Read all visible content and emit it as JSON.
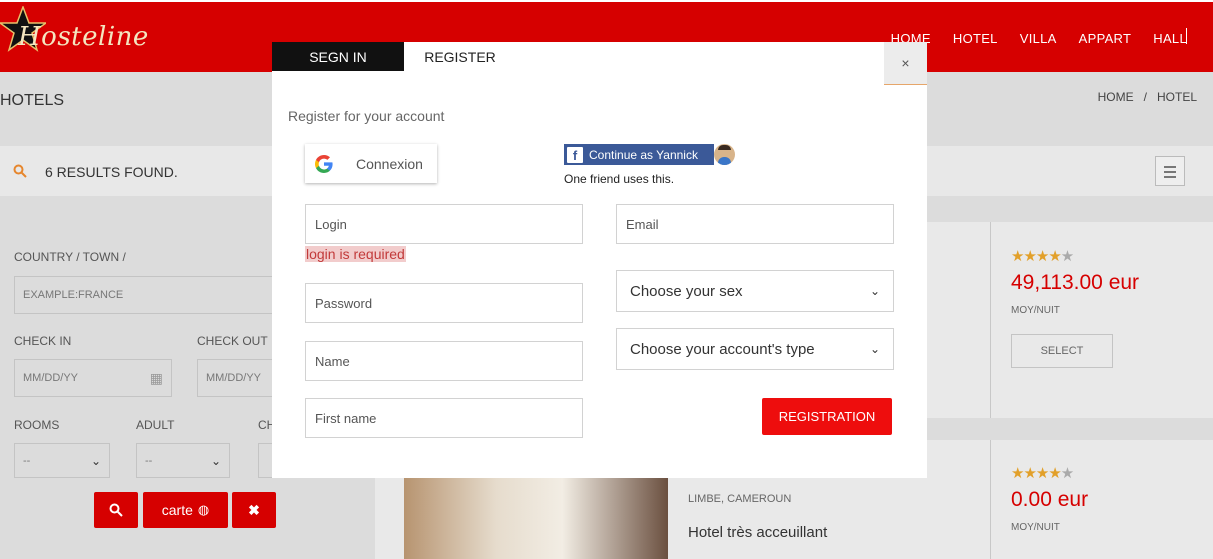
{
  "brand": {
    "logo_text": "Hosteline"
  },
  "nav": {
    "items": [
      "HOME",
      "HOTEL",
      "VILLA",
      "APPART",
      "HALL"
    ]
  },
  "page": {
    "title": "HOTELS",
    "breadcrumb": [
      "HOME",
      "/",
      "HOTEL"
    ]
  },
  "results": {
    "text": "6 RESULTS FOUND."
  },
  "filter": {
    "country_label": "COUNTRY / TOWN /",
    "country_placeholder": "EXAMPLE:FRANCE",
    "checkin_label": "CHECK IN",
    "checkout_label": "CHECK OUT",
    "checkin_placeholder": "MM/DD/YY",
    "checkout_placeholder": "MM/DD/YY",
    "rooms_label": "ROOMS",
    "adult_label": "ADULT",
    "children_label": "CH",
    "rooms_value": "--",
    "adult_value": "--",
    "carte_label": "carte"
  },
  "cards": [
    {
      "rating": 4,
      "price": "49,113.00 eur",
      "per_night": "MOY/NUIT",
      "select_label": "SELECT"
    },
    {
      "rating": 4,
      "price": "0.00 eur",
      "per_night": "MOY/NUIT",
      "location": "LIMBE, CAMEROUN",
      "title": "Hotel très acceuillant"
    }
  ],
  "modal": {
    "tab_signin": "SEGN IN",
    "tab_register": "REGISTER",
    "close": "×",
    "subtitle": "Register for your account",
    "google_label": "Connexion",
    "facebook_label": "Continue as Yannick",
    "facebook_friends": "One friend uses this.",
    "login_placeholder": "Login",
    "login_error": "login is required",
    "password_placeholder": "Password",
    "name_placeholder": "Name",
    "firstname_placeholder": "First name",
    "email_placeholder": "Email",
    "sex_select": "Choose your sex",
    "account_type_select": "Choose your account's type",
    "register_button": "REGISTRATION"
  },
  "colors": {
    "brand_red": "#d60000",
    "button_red": "#ee0d0d",
    "star": "#e2a02a"
  }
}
